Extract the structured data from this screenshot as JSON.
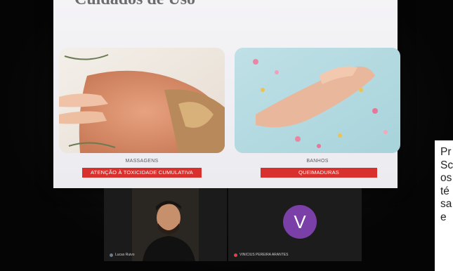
{
  "slide": {
    "title": "Cuidados de Uso",
    "cards": [
      {
        "caption": "MASSAGENS",
        "warning": "ATENÇÃO À TOXICIDADE CUMULATIVA",
        "image": "massage-photo"
      },
      {
        "caption": "BANHOS",
        "warning": "QUEIMADURAS",
        "image": "petal-bath-photo"
      }
    ]
  },
  "participants": [
    {
      "name": "Lucas Ruivo",
      "video": "camera-on",
      "mic": "on"
    },
    {
      "name": "VINICIUS PEREIRA ARANTES",
      "avatar_letter": "V",
      "avatar_color": "#7b3fa8",
      "mic": "muted"
    }
  ],
  "caption_overlay": {
    "lines": [
      "Pr",
      "Sc",
      "os",
      "té",
      "sa",
      "e"
    ]
  },
  "colors": {
    "warning_bar": "#d8302c",
    "slide_bg": "#f2f1f5"
  }
}
